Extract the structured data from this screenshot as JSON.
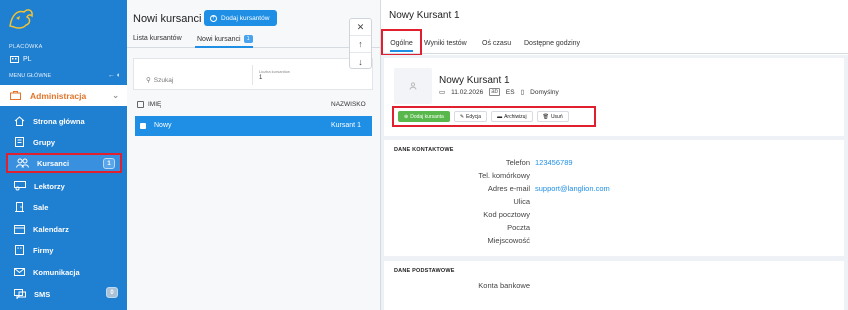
{
  "sidebar": {
    "placowka_label": "PLACÓWKA",
    "placowka_value": "PL",
    "menu_label": "MENU GŁÓWNE",
    "menu_controls": "← ◐",
    "admin_label": "Administracja",
    "items": [
      {
        "label": "Strona główna",
        "icon": "home-icon"
      },
      {
        "label": "Grupy",
        "icon": "book-icon"
      },
      {
        "label": "Kursanci",
        "icon": "users-icon",
        "badge": "1",
        "active": true
      },
      {
        "label": "Lektorzy",
        "icon": "teacher-icon"
      },
      {
        "label": "Sale",
        "icon": "door-icon"
      },
      {
        "label": "Kalendarz",
        "icon": "calendar-icon"
      },
      {
        "label": "Firmy",
        "icon": "building-icon"
      },
      {
        "label": "Komunikacja",
        "icon": "mail-icon"
      },
      {
        "label": "SMS",
        "icon": "chat-icon",
        "badge": "0"
      }
    ]
  },
  "list": {
    "title": "Nowi kursanci",
    "add_button": "Dodaj kursantów",
    "tabs": [
      {
        "label": "Lista kursantów"
      },
      {
        "label": "Nowi kursanci",
        "count": "1"
      }
    ],
    "search_placeholder": "Szukaj",
    "count_label": "Liczba kursantów",
    "count_value": "1",
    "col_first": "IMIĘ",
    "col_last": "NAZWISKO",
    "rows": [
      {
        "first": "Nowy",
        "last": "Kursant 1"
      }
    ]
  },
  "float_controls": [
    "✕",
    "↑",
    "↓"
  ],
  "detail": {
    "title": "Nowy Kursant 1",
    "tabs": [
      "Ogólne",
      "Wyniki testów",
      "Oś czasu",
      "Dostępne godziny"
    ],
    "name": "Nowy Kursant 1",
    "date": "11.02.2026",
    "lang": "ES",
    "template": "Domyślny",
    "actions": [
      "Dodaj kursanta",
      "Edycja",
      "Archiwizuj",
      "Usuń"
    ],
    "contact_title": "DANE KONTAKTOWE",
    "contact": [
      {
        "k": "Telefon",
        "v": "123456789"
      },
      {
        "k": "Tel. komórkowy",
        "v": ""
      },
      {
        "k": "Adres e-mail",
        "v": "support@langlion.com"
      },
      {
        "k": "Ulica",
        "v": ""
      },
      {
        "k": "Kod pocztowy",
        "v": ""
      },
      {
        "k": "Poczta",
        "v": ""
      },
      {
        "k": "Miejscowość",
        "v": ""
      }
    ],
    "basic_title": "DANE PODSTAWOWE",
    "basic": [
      {
        "k": "Konta bankowe",
        "v": ""
      }
    ]
  },
  "colors": {
    "accent": "#1f8fe6",
    "sidebar": "#1f7fd0",
    "highlight": "#e0202e",
    "admin": "#e0742a",
    "green": "#59b84b"
  }
}
